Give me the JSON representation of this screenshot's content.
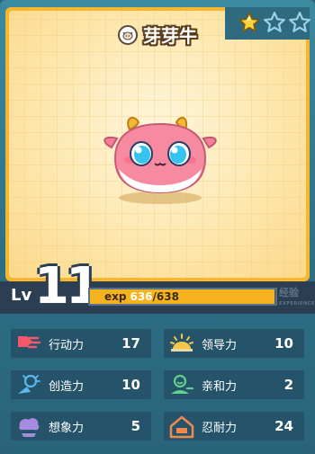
{
  "pet": {
    "name": "芽芽牛",
    "icon": "cow-face-icon",
    "stars_filled": 1,
    "stars_total": 3
  },
  "level": {
    "label": "Lv",
    "value": "11",
    "exp_label": "exp",
    "exp_current": "636",
    "exp_max": "638",
    "exp_fraction": 0.997,
    "exp_tag": "经验",
    "exp_tag_sub": "EXPERIENCE"
  },
  "stats": [
    {
      "label": "行动力",
      "value": "17",
      "icon": "action-dash-icon"
    },
    {
      "label": "领导力",
      "value": "10",
      "icon": "leadership-sun-icon"
    },
    {
      "label": "创造力",
      "value": "10",
      "icon": "creativity-bulb-icon"
    },
    {
      "label": "亲和力",
      "value": "2",
      "icon": "affinity-person-icon"
    },
    {
      "label": "想象力",
      "value": "5",
      "icon": "imagination-cloud-icon"
    },
    {
      "label": "忍耐力",
      "value": "24",
      "icon": "endurance-house-icon"
    }
  ],
  "colors": {
    "accent": "#f7b21f",
    "panel": "#25546a",
    "card": "#f6b72e"
  }
}
